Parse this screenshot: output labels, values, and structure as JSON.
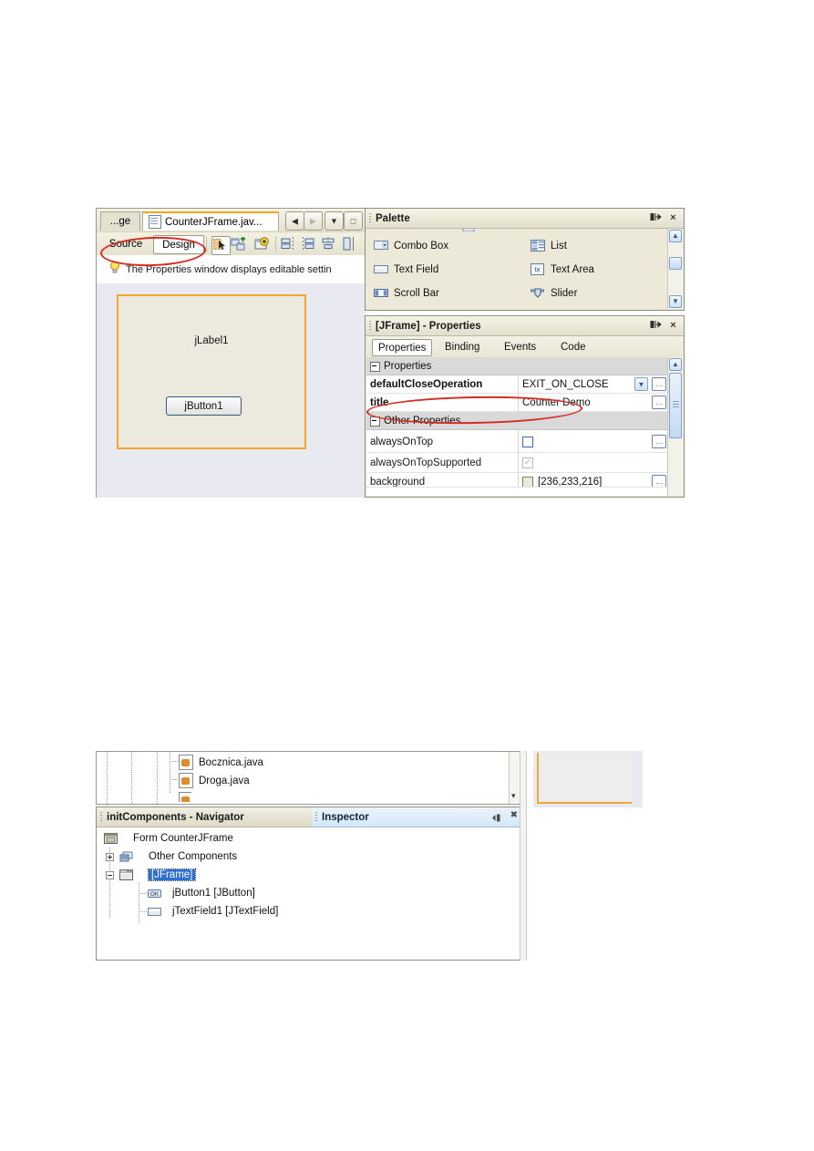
{
  "editor": {
    "tabs": [
      {
        "label": "...ge",
        "active": false,
        "icon": "none"
      },
      {
        "label": "CounterJFrame.jav...",
        "active": true,
        "icon": "java-file-icon"
      }
    ],
    "nav_buttons": [
      {
        "name": "scroll-tabs-left-button",
        "glyph": "◀",
        "disabled": false
      },
      {
        "name": "scroll-tabs-right-button",
        "glyph": "▶",
        "disabled": true
      },
      {
        "name": "tab-list-dropdown-button",
        "glyph": "▼",
        "disabled": false
      },
      {
        "name": "maximize-window-button",
        "glyph": "□",
        "disabled": false
      }
    ],
    "toolbar": {
      "source_label": "Source",
      "design_label": "Design",
      "icons": [
        "selection-mode-icon",
        "connection-mode-icon",
        "preview-design-icon",
        "align-left-icon",
        "align-right-icon",
        "align-center-icon",
        "align-more-icon"
      ]
    },
    "hint": {
      "icon": "lightbulb-icon",
      "text": "The Properties window displays editable settin"
    },
    "canvas": {
      "label_text": "jLabel1",
      "button_text": "jButton1",
      "form_border_color": "#f0a830",
      "form_fill_color": "#eceade",
      "canvas_color": "#e9e9f2"
    }
  },
  "palette": {
    "title": "Palette",
    "float_button": "float-window-icon",
    "close_button": "×",
    "items": [
      {
        "label": "Combo Box",
        "icon": "combo-box-icon",
        "col": 0,
        "row": 0
      },
      {
        "label": "List",
        "icon": "list-icon",
        "col": 1,
        "row": 0
      },
      {
        "label": "Text Field",
        "icon": "text-field-icon",
        "col": 0,
        "row": 1
      },
      {
        "label": "Text Area",
        "icon": "text-area-icon",
        "col": 1,
        "row": 1
      },
      {
        "label": "Scroll Bar",
        "icon": "scroll-bar-icon",
        "col": 0,
        "row": 2
      },
      {
        "label": "Slider",
        "icon": "slider-icon",
        "col": 1,
        "row": 2
      }
    ]
  },
  "properties": {
    "title": "[JFrame] - Properties",
    "float_button": "float-window-icon",
    "close_button": "×",
    "tabs": [
      {
        "label": "Properties",
        "selected": true
      },
      {
        "label": "Binding",
        "selected": false
      },
      {
        "label": "Events",
        "selected": false
      },
      {
        "label": "Code",
        "selected": false
      }
    ],
    "groups": [
      {
        "label": "Properties",
        "expanded": true
      },
      {
        "label": "Other Properties",
        "expanded": true
      }
    ],
    "rows": [
      {
        "name": "defaultCloseOperation",
        "value": "EXIT_ON_CLOSE",
        "bold": true,
        "editor": "combo",
        "highlighted": false
      },
      {
        "name": "title",
        "value": "Counter Demo",
        "bold": true,
        "editor": "text",
        "highlighted": true
      },
      {
        "name": "alwaysOnTop",
        "value": "",
        "bold": false,
        "editor": "checkbox",
        "checked": false,
        "enabled": true
      },
      {
        "name": "alwaysOnTopSupported",
        "value": "",
        "bold": false,
        "editor": "checkbox",
        "checked": true,
        "enabled": false
      },
      {
        "name": "background",
        "value": "[236,233,216]",
        "bold": false,
        "editor": "color",
        "swatch": "#ece9d8"
      }
    ]
  },
  "project_tree": {
    "items": [
      {
        "label": "Bocznica.java",
        "icon": "java-file-icon"
      },
      {
        "label": "Droga.java",
        "icon": "java-file-icon"
      }
    ],
    "scroll_down_glyph": "▾"
  },
  "navigator": {
    "title": "initComponents - Navigator",
    "inspector_title": "Inspector",
    "inspector_buttons": [
      {
        "name": "minimize-window-icon",
        "glyph": "◧"
      },
      {
        "name": "close-icon",
        "glyph": "✖"
      }
    ],
    "tree": [
      {
        "label": "Form CounterJFrame",
        "indent": 0,
        "icon": "form-icon",
        "expander": "none",
        "selected": false
      },
      {
        "label": "Other Components",
        "indent": 0,
        "icon": "components-icon",
        "expander": "plus",
        "selected": false
      },
      {
        "label": "[JFrame]",
        "indent": 0,
        "icon": "jframe-icon",
        "expander": "minus",
        "selected": true
      },
      {
        "label": "jButton1 [JButton]",
        "indent": 1,
        "icon": "jbutton-icon",
        "expander": "none",
        "selected": false
      },
      {
        "label": "jTextField1 [JTextField]",
        "indent": 1,
        "icon": "jtextfield-icon",
        "expander": "none",
        "selected": false
      }
    ]
  },
  "annotations": {
    "ink_color": "#d62b20",
    "marks": [
      {
        "name": "ink-ellipse-source-design-tabs"
      },
      {
        "name": "ink-ellipse-title-property-row"
      }
    ]
  }
}
